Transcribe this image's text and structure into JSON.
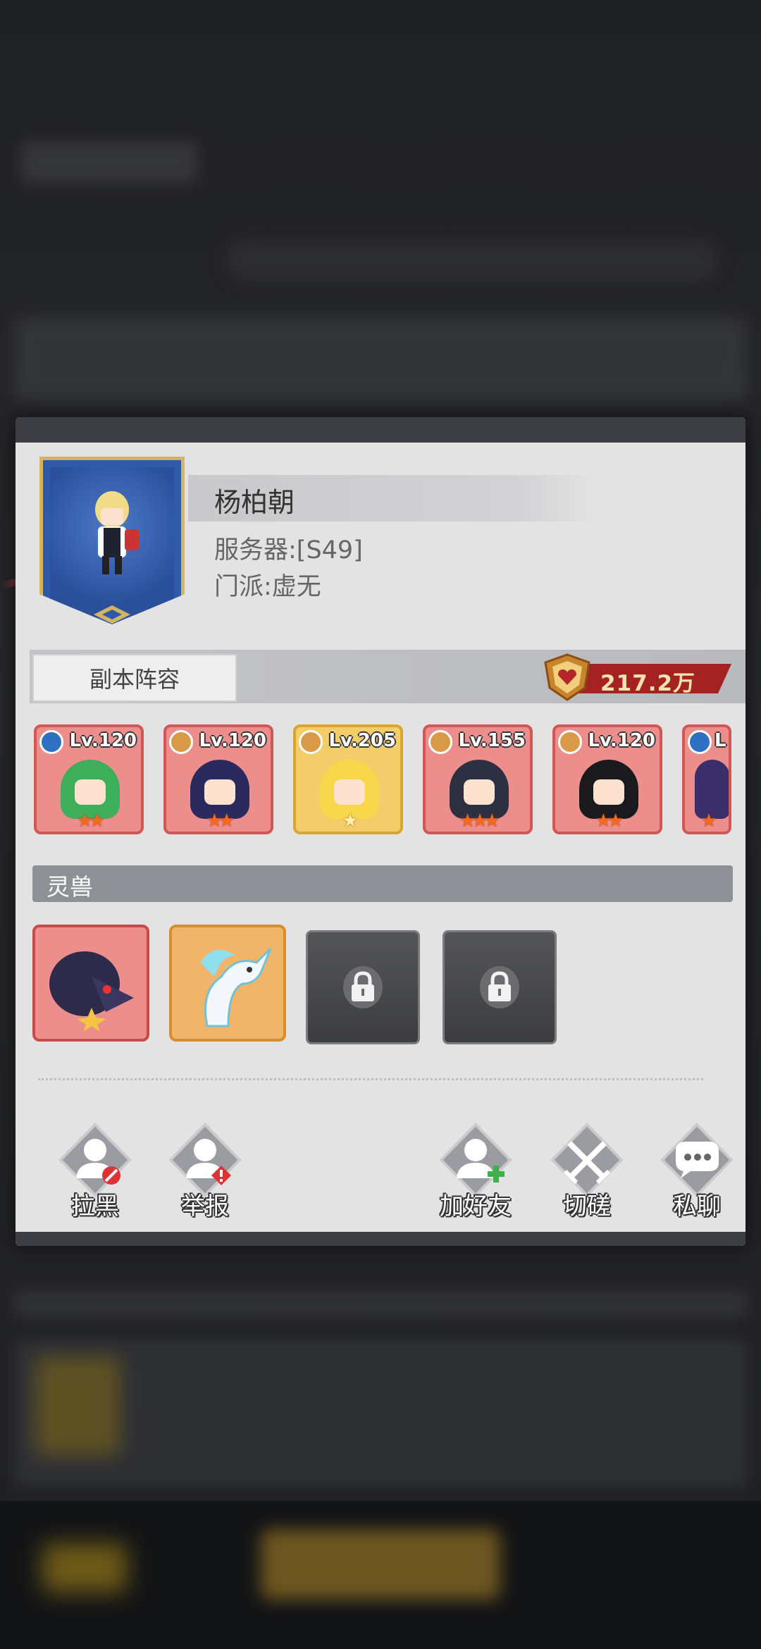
{
  "profile": {
    "name": "杨柏朝",
    "server": "服务器:[S49]",
    "sect": "门派:虚无"
  },
  "formation": {
    "tab_label": "副本阵容",
    "power": "217.2万"
  },
  "heroes": [
    {
      "level": "Lv.120",
      "element": "water",
      "stars": "★★",
      "frame": "red"
    },
    {
      "level": "Lv.120",
      "element": "lotus",
      "stars": "★★",
      "frame": "red"
    },
    {
      "level": "Lv.205",
      "element": "lotus",
      "stars": "★",
      "frame": "gold"
    },
    {
      "level": "Lv.155",
      "element": "lotus",
      "stars": "★★★",
      "frame": "red"
    },
    {
      "level": "Lv.120",
      "element": "lotus",
      "stars": "★★",
      "frame": "red"
    },
    {
      "level": "L",
      "element": "water",
      "stars": "★",
      "frame": "red"
    }
  ],
  "spirit_beast": {
    "title": "灵兽",
    "slots": [
      {
        "state": "dark-dragon"
      },
      {
        "state": "white-qilin"
      },
      {
        "state": "locked"
      },
      {
        "state": "locked"
      }
    ]
  },
  "actions": {
    "block": "拉黑",
    "report": "举报",
    "add_friend": "加好友",
    "duel": "切磋",
    "chat": "私聊"
  },
  "colors": {
    "accent_red": "#a52222",
    "banner_blue": "#2f5aa8",
    "gold": "#d4b362"
  }
}
